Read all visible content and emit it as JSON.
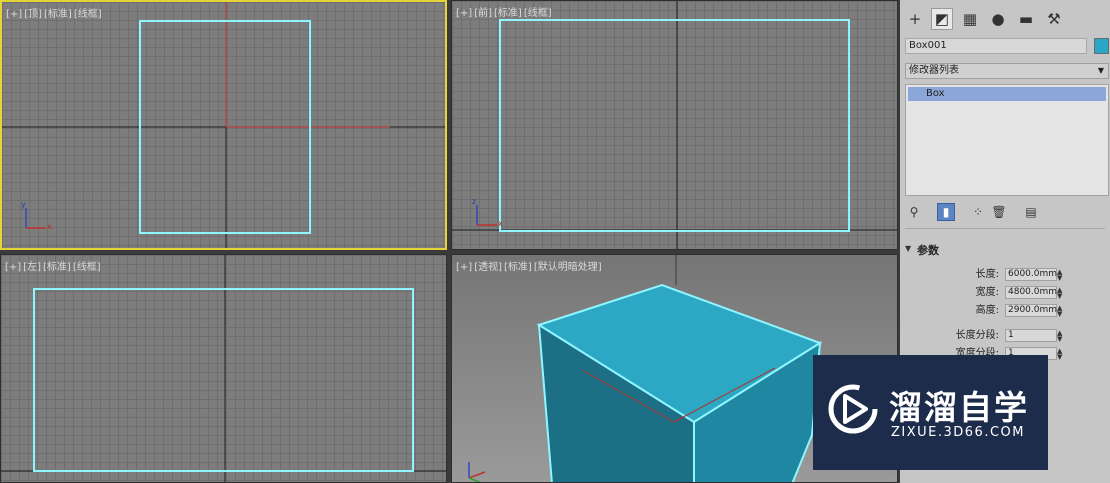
{
  "viewports": {
    "top": {
      "labels": [
        "[+]",
        "[顶]",
        "[标准]",
        "[线框]"
      ]
    },
    "front": {
      "labels": [
        "[+]",
        "[前]",
        "[标准]",
        "[线框]"
      ]
    },
    "left": {
      "labels": [
        "[+]",
        "[左]",
        "[标准]",
        "[线框]"
      ]
    },
    "perspective": {
      "labels": [
        "[+]",
        "[透视]",
        "[标准]",
        "[默认明暗处理]"
      ]
    },
    "axis": {
      "x": "x",
      "y": "y",
      "z": "z"
    }
  },
  "command_panel": {
    "tabs": [
      {
        "icon": "create-icon",
        "glyph": "+"
      },
      {
        "icon": "modify-icon",
        "glyph": "◩"
      },
      {
        "icon": "hierarchy-icon",
        "glyph": "▦"
      },
      {
        "icon": "motion-icon",
        "glyph": "●"
      },
      {
        "icon": "display-icon",
        "glyph": "▬"
      },
      {
        "icon": "utilities-icon",
        "glyph": "⚒"
      }
    ],
    "object_name": "Box001",
    "object_color": "#29a7c9",
    "modifier_list": "修改器列表",
    "stack_items": [
      "Box"
    ],
    "stack_tools": [
      "pin-icon",
      "show-end-result-icon",
      "make-unique-icon",
      "remove-modifier-icon",
      "configure-icon"
    ],
    "params_title": "参数",
    "params": [
      {
        "label": "长度:",
        "value": "6000.0mm"
      },
      {
        "label": "宽度:",
        "value": "4800.0mm"
      },
      {
        "label": "高度:",
        "value": "2900.0mm"
      }
    ],
    "segments": [
      {
        "label": "长度分段:",
        "value": "1"
      },
      {
        "label": "宽度分段:",
        "value": "1"
      }
    ]
  },
  "watermark": {
    "title": "溜溜自学",
    "url": "ZIXUE.3D66.COM"
  },
  "colors": {
    "viewport_bg": "#7d7d7d",
    "active_border": "#e5d33a",
    "selection_cyan": "#8ff5ff",
    "box_fill": "#29a7c9"
  }
}
